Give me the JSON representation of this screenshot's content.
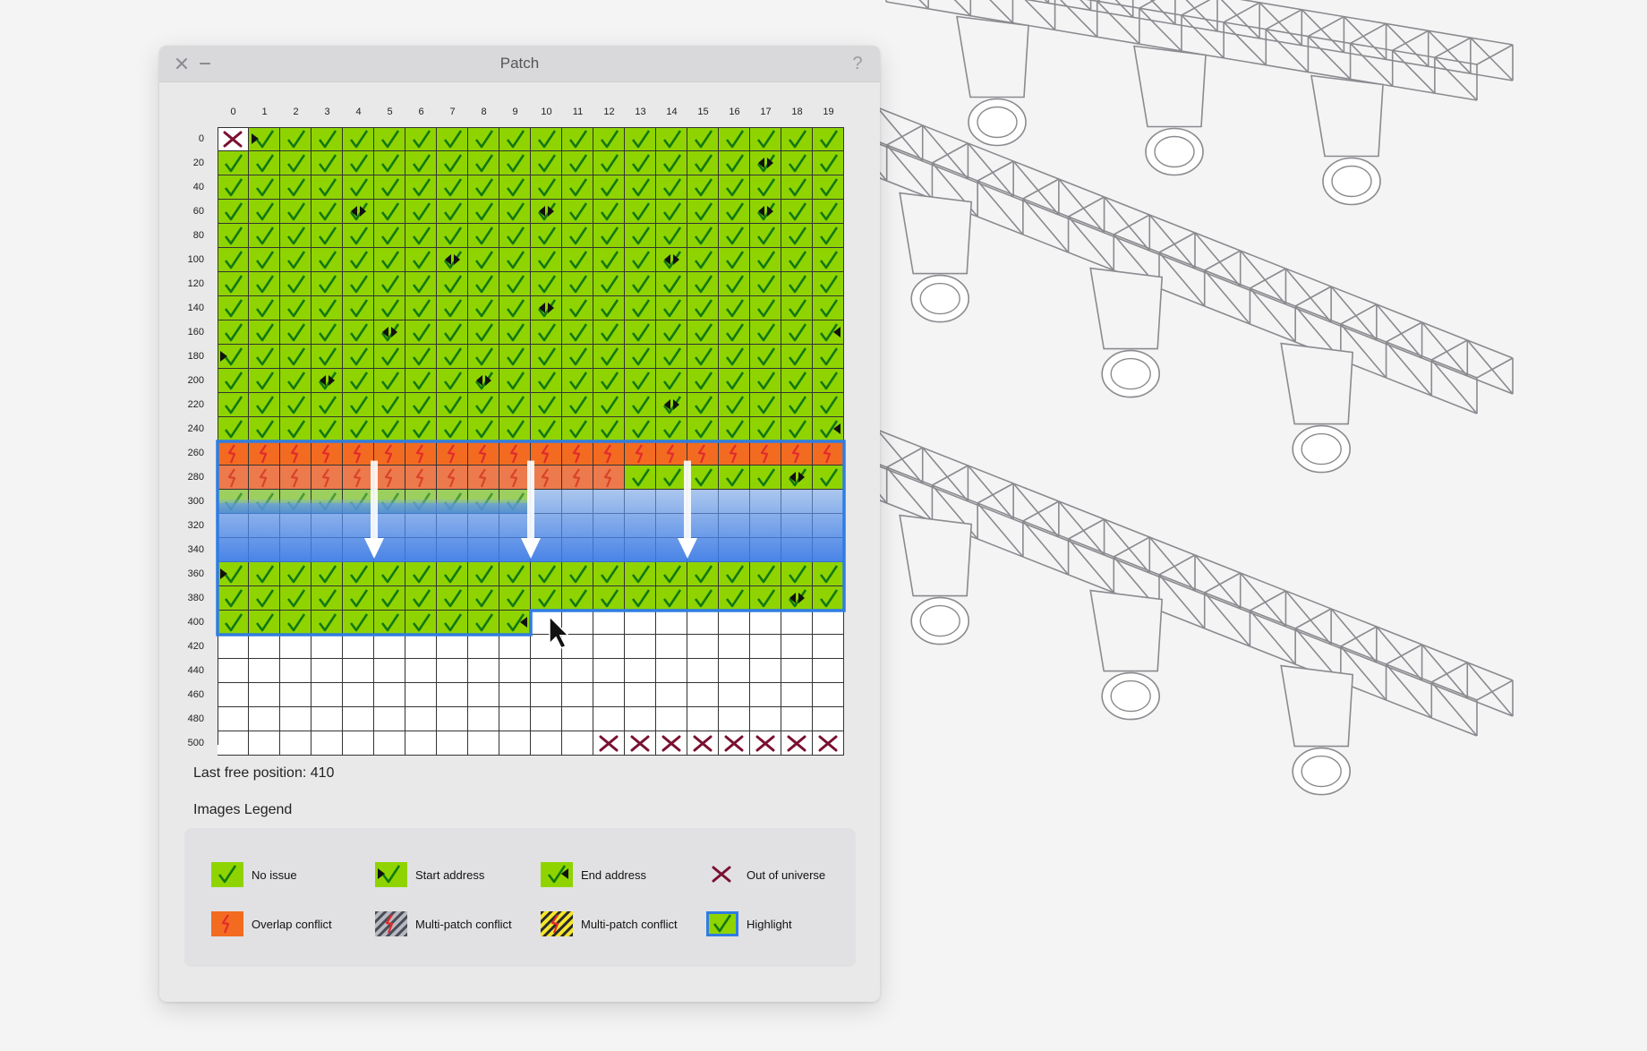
{
  "window": {
    "title": "Patch",
    "help_label": "?"
  },
  "grid": {
    "columns": [
      "0",
      "1",
      "2",
      "3",
      "4",
      "5",
      "6",
      "7",
      "8",
      "9",
      "10",
      "11",
      "12",
      "13",
      "14",
      "15",
      "16",
      "17",
      "18",
      "19"
    ],
    "rows": [
      "0",
      "20",
      "40",
      "60",
      "80",
      "100",
      "120",
      "140",
      "160",
      "180",
      "200",
      "220",
      "240",
      "260",
      "280",
      "300",
      "320",
      "340",
      "360",
      "380",
      "400",
      "420",
      "440",
      "460",
      "480",
      "500"
    ],
    "states_legend": "G=no issue, S=start address, E=end address, B=end+start, X=out of universe, O=overlap conflict, P=partial/faded, W=empty, Y=highlighted empty band",
    "cells": [
      "XSGGGGGGGGGGGGGGGGGG",
      "GGGGGGGGGGGGGGGGGBGG",
      "GGGGGGGGGGGGGGGGGGGG",
      "GGGGBGGGGGBGGGGGGBGG",
      "GGGGGGGGGGGGGGGGGGGG",
      "GGGGGGGBGGGGGGBGGGGG",
      "GGGGGGGGGGGGGGGGGGGG",
      "GGGGGGGGGGBGGGGGGGGG",
      "GGGGGBGGGGGGGGGGGGGE",
      "SGGGGGGGGGGGGGGGGGGG",
      "GGGBGGGGBGGGGGGGGGGG",
      "GGGGGGGGGGGGGGBGGGGG",
      "GGGGGGGGGGGGGGGGGGGE",
      "OOOOOOOOOOOOOOOOOOOO",
      "OOOOOOOOOOOOOGGGGGBG",
      "PPPPPPPPPPYYYYYYYYYY",
      "YYYYYYYYYYYYYYYYYYYY",
      "YYYYYYYYYYYYYYYYYYYY",
      "SGGGGGGGGGGGGGGGGGGG",
      "GGGGGGGGGGGGGGGGGGBG",
      "GGGGGGGGGEWWWWWWWWWW",
      "WWWWWWWWWWWWWWWWWWWW",
      "WWWWWWWWWWWWWWWWWWWW",
      "WWWWWWWWWWWWWWWWWWWW",
      "WWWWWWWWWWWWWWWWWWWW",
      "WWWWWWWWWWWWXXXXXXXX"
    ]
  },
  "status": {
    "last_free_label": "Last free position: 410"
  },
  "legend": {
    "title": "Images Legend",
    "items": [
      {
        "key": "no-issue",
        "label": "No issue"
      },
      {
        "key": "start-address",
        "label": "Start address"
      },
      {
        "key": "end-address",
        "label": "End address"
      },
      {
        "key": "out-of-universe",
        "label": "Out of universe"
      },
      {
        "key": "overlap-conflict",
        "label": "Overlap conflict"
      },
      {
        "key": "multi-patch-conflict-gray",
        "label": "Multi-patch conflict"
      },
      {
        "key": "multi-patch-conflict-yellow",
        "label": "Multi-patch conflict"
      },
      {
        "key": "highlight",
        "label": "Highlight"
      }
    ]
  },
  "colors": {
    "green": "#8fd400",
    "orange": "#f26b21",
    "highlight_blue": "#2f7de1",
    "out_of_universe": "#7a1030",
    "check": "#127812"
  },
  "icons": [
    "close-icon",
    "minimize-icon",
    "help-icon",
    "check-icon",
    "start-arrow-icon",
    "end-arrow-icon",
    "cross-icon",
    "lightning-icon",
    "move-arrow-icon",
    "mouse-cursor-icon",
    "truss-illustration"
  ]
}
